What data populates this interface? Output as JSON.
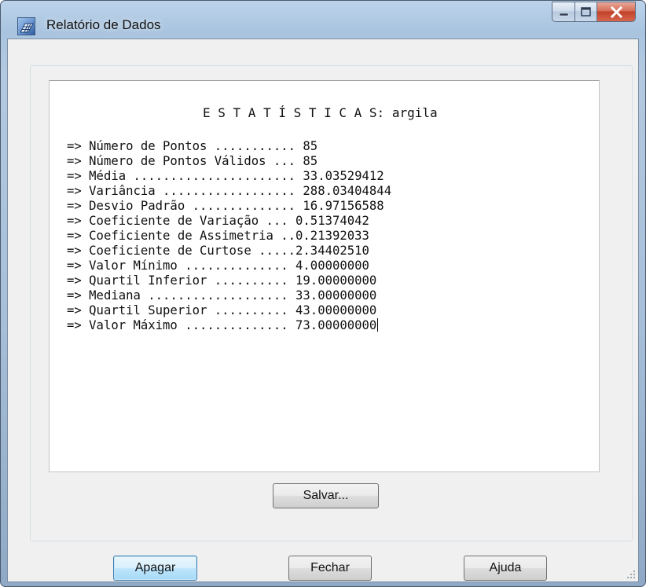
{
  "window": {
    "title": "Relatório de Dados",
    "controls": {
      "minimize": "minimize",
      "maximize": "maximize",
      "close": "close"
    }
  },
  "report": {
    "title": "E S T A T Í S T I C A S: argila",
    "lines": [
      "=> Número de Pontos ........... 85",
      "=> Número de Pontos Válidos ... 85",
      "=> Média ...................... 33.03529412",
      "=> Variância .................. 288.03404844",
      "=> Desvio Padrão .............. 16.97156588",
      "=> Coeficiente de Variação ... 0.51374042",
      "=> Coeficiente de Assimetria ..0.21392033",
      "=> Coeficiente de Curtose .....2.34402510",
      "=> Valor Mínimo .............. 4.00000000",
      "=> Quartil Inferior .......... 19.00000000",
      "=> Mediana ................... 33.00000000",
      "=> Quartil Superior .......... 43.00000000",
      "=> Valor Máximo .............. 73.00000000"
    ]
  },
  "buttons": {
    "save": "Salvar...",
    "clear": "Apagar",
    "close": "Fechar",
    "help": "Ajuda"
  },
  "icons": {
    "app": "map-grid-icon",
    "minimize": "minimize-icon",
    "maximize": "maximize-icon",
    "close": "close-icon",
    "resize": "resize-grip-icon"
  },
  "colors": {
    "frame": "#a9c4df",
    "close_button": "#c2412a",
    "default_button": "#3c7fb1"
  }
}
